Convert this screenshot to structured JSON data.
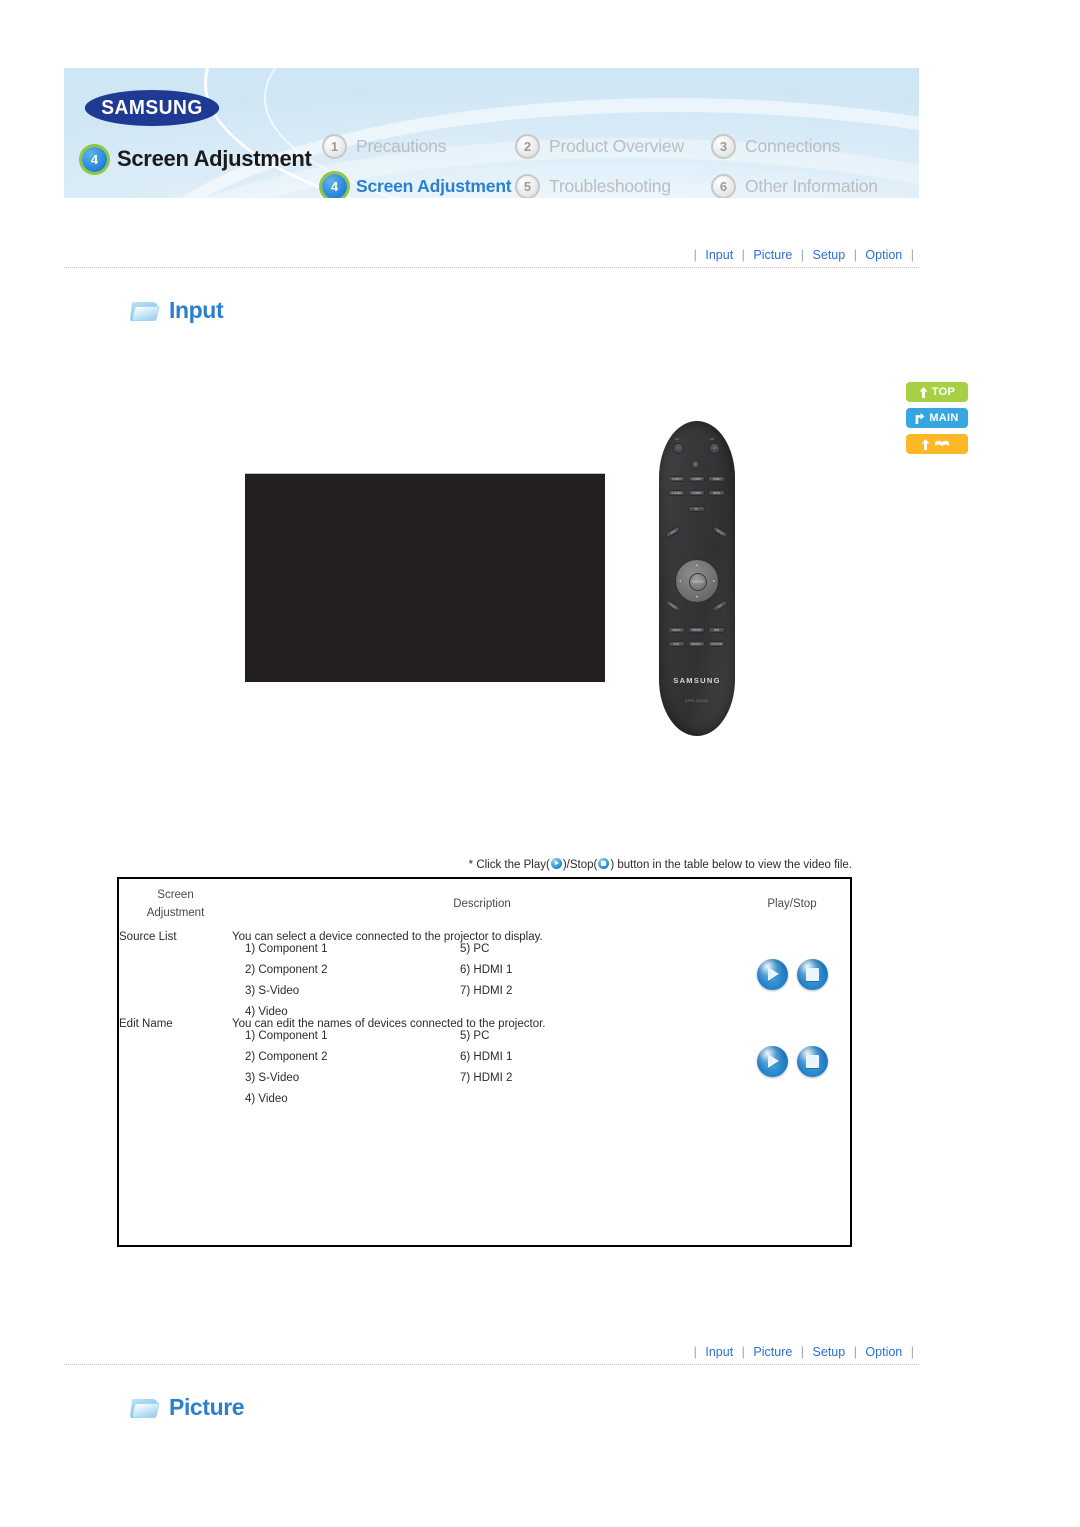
{
  "header": {
    "brand": "SAMSUNG",
    "page_badge": "4",
    "page_title": "Screen Adjustment",
    "nav_items": [
      {
        "num": "1",
        "label": "Precautions",
        "active": false
      },
      {
        "num": "2",
        "label": "Product Overview",
        "active": false
      },
      {
        "num": "3",
        "label": "Connections",
        "active": false
      },
      {
        "num": "4",
        "label": "Screen Adjustment",
        "active": true
      },
      {
        "num": "5",
        "label": "Troubleshooting",
        "active": false
      },
      {
        "num": "6",
        "label": "Other Information",
        "active": false
      }
    ]
  },
  "subnav": {
    "items": [
      "Input",
      "Picture",
      "Setup",
      "Option"
    ],
    "separator": "|"
  },
  "sections": {
    "input_title": "Input",
    "picture_title": "Picture"
  },
  "side_buttons": [
    {
      "label": "TOP",
      "color": "#a8d045",
      "icon": "arrow-up-icon"
    },
    {
      "label": "MAIN",
      "color": "#34a7e0",
      "icon": "arrow-turn-icon"
    },
    {
      "label": "",
      "color": "#fcb827",
      "icon": "book-icon"
    }
  ],
  "media": {
    "remote": {
      "brand": "SAMSUNG",
      "model": "BP59-00138A",
      "on_label": "On",
      "off_label": "Off",
      "enter_label": "ENTER",
      "keys_row1": [
        "COMP1",
        "COMP2",
        "VIDEO"
      ],
      "keys_row2": [
        "S-VIDEO",
        "COMP3",
        "HDMI1"
      ],
      "keys_row3": [
        "PC"
      ],
      "keys_row4": [
        "MAGIC",
        "PMODE",
        "SIZE"
      ],
      "keys_row5": [
        "STILL",
        "INSTALL",
        "CUSTOM"
      ],
      "corner_keys": [
        "INFO",
        "MENU",
        "PSIZE",
        "EXIT"
      ]
    }
  },
  "table": {
    "note_prefix": "* Click the Play(",
    "note_middle": ")/Stop(",
    "note_suffix": ") button in the table below to view the video file.",
    "headers": {
      "col1_line1": "Screen",
      "col1_line2": "Adjustment",
      "col2": "Description",
      "col3": "Play/Stop"
    },
    "rows": [
      {
        "label": "Source List",
        "description": "You can select a device connected to the projector to display.",
        "items_left": [
          "1) Component 1",
          "2) Component 2",
          "3) S-Video",
          "4) Video"
        ],
        "items_right": [
          "5) PC",
          "6) HDMI 1",
          "7) HDMI 2"
        ],
        "play_icon": "play-icon",
        "stop_icon": "stop-icon"
      },
      {
        "label": "Edit Name",
        "description": "You can edit the names of devices connected to the projector.",
        "items_left": [
          "1) Component 1",
          "2) Component 2",
          "3) S-Video",
          "4) Video"
        ],
        "items_right": [
          "5) PC",
          "6) HDMI 1",
          "7) HDMI 2"
        ],
        "play_icon": "play-icon",
        "stop_icon": "stop-icon"
      }
    ]
  }
}
